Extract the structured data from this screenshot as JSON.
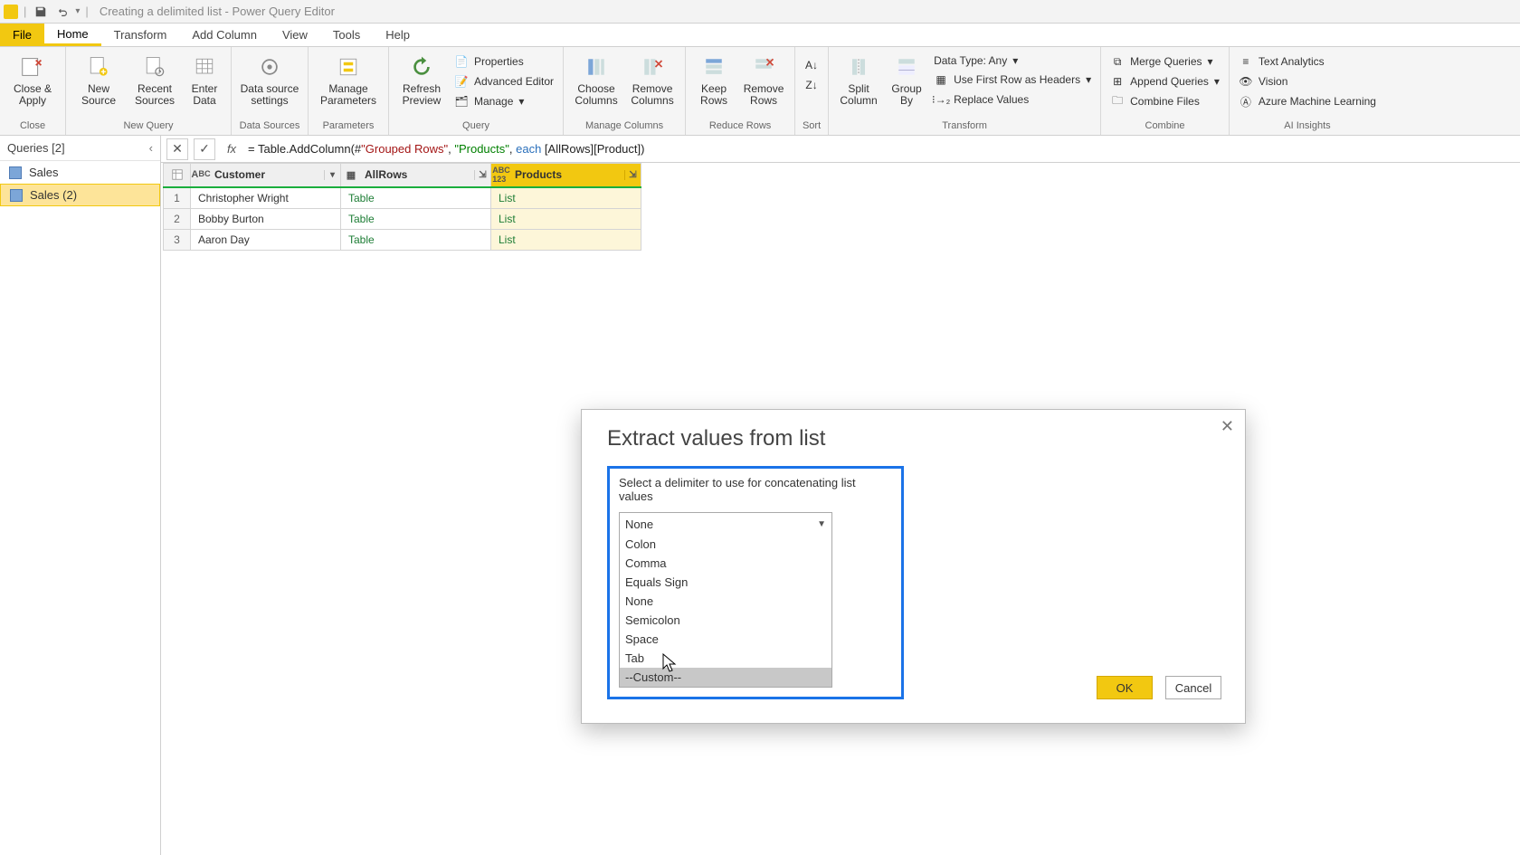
{
  "window": {
    "title": "Creating a delimited list - Power Query Editor"
  },
  "tabs": {
    "file": "File",
    "home": "Home",
    "transform": "Transform",
    "add_column": "Add Column",
    "view": "View",
    "tools": "Tools",
    "help": "Help"
  },
  "ribbon": {
    "close": {
      "label": "Close &\nApply",
      "group": "Close"
    },
    "new_source": "New\nSource",
    "recent_sources": "Recent\nSources",
    "enter_data": "Enter\nData",
    "new_query_group": "New Query",
    "data_source_settings": "Data source\nsettings",
    "data_sources_group": "Data Sources",
    "manage_parameters": "Manage\nParameters",
    "parameters_group": "Parameters",
    "refresh_preview": "Refresh\nPreview",
    "properties": "Properties",
    "advanced_editor": "Advanced Editor",
    "manage": "Manage",
    "query_group": "Query",
    "choose_columns": "Choose\nColumns",
    "remove_columns": "Remove\nColumns",
    "manage_columns_group": "Manage Columns",
    "keep_rows": "Keep\nRows",
    "remove_rows": "Remove\nRows",
    "reduce_rows_group": "Reduce Rows",
    "sort_group": "Sort",
    "split_column": "Split\nColumn",
    "group_by": "Group\nBy",
    "data_type": "Data Type: Any",
    "use_first_row": "Use First Row as Headers",
    "replace_values": "Replace Values",
    "transform_group": "Transform",
    "merge_queries": "Merge Queries",
    "append_queries": "Append Queries",
    "combine_files": "Combine Files",
    "combine_group": "Combine",
    "text_analytics": "Text Analytics",
    "vision": "Vision",
    "azure_ml": "Azure Machine Learning",
    "ai_group": "AI Insights"
  },
  "queries": {
    "header": "Queries [2]",
    "items": [
      "Sales",
      "Sales (2)"
    ]
  },
  "formula": {
    "prefix": "= Table.AddColumn(#",
    "arg1": "\"Grouped Rows\"",
    "sep1": ", ",
    "arg2": "\"Products\"",
    "sep2": ", ",
    "kw": "each",
    "rest": " [AllRows][Product])"
  },
  "grid": {
    "cols": [
      "Customer",
      "AllRows",
      "Products"
    ],
    "rows": [
      {
        "n": "1",
        "customer": "Christopher Wright",
        "allrows": "Table",
        "products": "List"
      },
      {
        "n": "2",
        "customer": "Bobby Burton",
        "allrows": "Table",
        "products": "List"
      },
      {
        "n": "3",
        "customer": "Aaron Day",
        "allrows": "Table",
        "products": "List"
      }
    ]
  },
  "dialog": {
    "title": "Extract values from list",
    "prompt": "Select a delimiter to use for concatenating list values",
    "selected": "None",
    "options": [
      "Colon",
      "Comma",
      "Equals Sign",
      "None",
      "Semicolon",
      "Space",
      "Tab",
      "--Custom--"
    ],
    "ok": "OK",
    "cancel": "Cancel"
  }
}
